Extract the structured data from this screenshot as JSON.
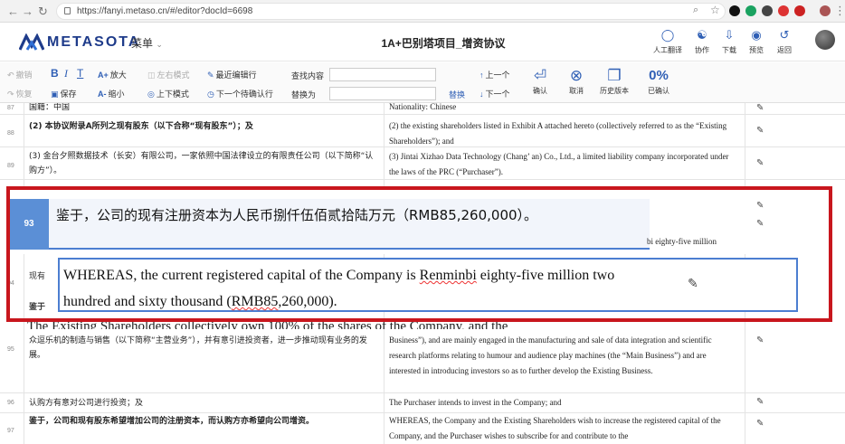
{
  "browser": {
    "url": "https://fanyi.metaso.cn/#/editor?docId=6698"
  },
  "app": {
    "logo_text": "METASOTA",
    "menu_label": "菜单",
    "doc_title": "1A+巴别塔项目_增资协议",
    "header_buttons": [
      {
        "label": "人工翻译",
        "icon": "person-icon"
      },
      {
        "label": "协作",
        "icon": "people-icon"
      },
      {
        "label": "下载",
        "icon": "download-icon"
      },
      {
        "label": "预览",
        "icon": "eye-icon"
      },
      {
        "label": "返回",
        "icon": "return-icon"
      }
    ]
  },
  "toolbar": {
    "undo": "撤销",
    "redo": "恢复",
    "bold": "B",
    "italic": "I",
    "clear_format": "T",
    "zoom_in": "放大",
    "zoom_out": "缩小",
    "save": "保存",
    "lr_mode": "左右模式",
    "tb_mode": "上下模式",
    "recent_edit": "最近编辑行",
    "next_unconfirmed": "下一个待确认行",
    "find_label": "查找内容",
    "replace_label": "替换为",
    "replace_btn": "替换",
    "prev": "上一个",
    "next": "下一个",
    "confirm": "确认",
    "cancel": "取消",
    "history": "历史版本",
    "confirmed_pct": "0%",
    "confirmed_label": "已确认"
  },
  "rows": [
    {
      "num": "87",
      "zh": "国籍：中国",
      "en": "Nationality: Chinese"
    },
    {
      "num": "88",
      "zh": "(2)      本协议附录A所列之现有股东（以下合称“现有股东”）；及",
      "en": "(2) the existing shareholders listed in Exhibit A attached hereto (collectively referred to as the “Existing Shareholders”); and"
    },
    {
      "num": "89",
      "zh": "(3)      金台夕照数据技术（长安）有限公司，一家依照中国法律设立的有限责任公司（以下简称“认购方”）。",
      "en": "(3) Jintai Xizhao Data Technology (Chang’ an) Co., Ltd., a limited liability company incorporated under the laws of the PRC (“Purchaser”)."
    },
    {
      "num": "95",
      "zh": "众逗乐机的制造与销售（以下简称“主营业务”），并有意引进投资者，进一步推动现有业务的发展。",
      "en": "Business”), and are mainly engaged in the manufacturing and sale of data integration and scientific research platforms relating to humour and audience play machines (the “Main Business”) and are interested in introducing investors so as to further develop the Existing Business."
    },
    {
      "num": "96",
      "zh": "认购方有意对公司进行投资；及",
      "en": "The Purchaser intends to invest in the Company; and"
    },
    {
      "num": "97",
      "zh": "鉴于，公司和现有股东希望增加公司的注册资本，而认购方亦希望向公司增资。",
      "en": "WHEREAS, the Company and the Existing Shareholders wish to increase the registered capital of the Company, and the Purchaser wishes to subscribe for and contribute to the"
    }
  ],
  "active_row": {
    "num": "93",
    "zh": "鉴于，公司的现有注册资本为人民币捌仟伍佰贰拾陆万元（RMB85,260,000）。",
    "side_en": "bi eighty-five million",
    "en_part1": "WHEREAS, the current registered capital of the Company is ",
    "en_sq1": "Renminbi",
    "en_part2": " eighty-five million two hundred and sixty thousand (",
    "en_sq2": "RMB85",
    "en_part3": ",260,000).",
    "under_text": "The Existing Shareholders collectively own 100% of the shares of the Company, and the",
    "row94_stub": "现有",
    "row_stub2": "鉴于"
  }
}
